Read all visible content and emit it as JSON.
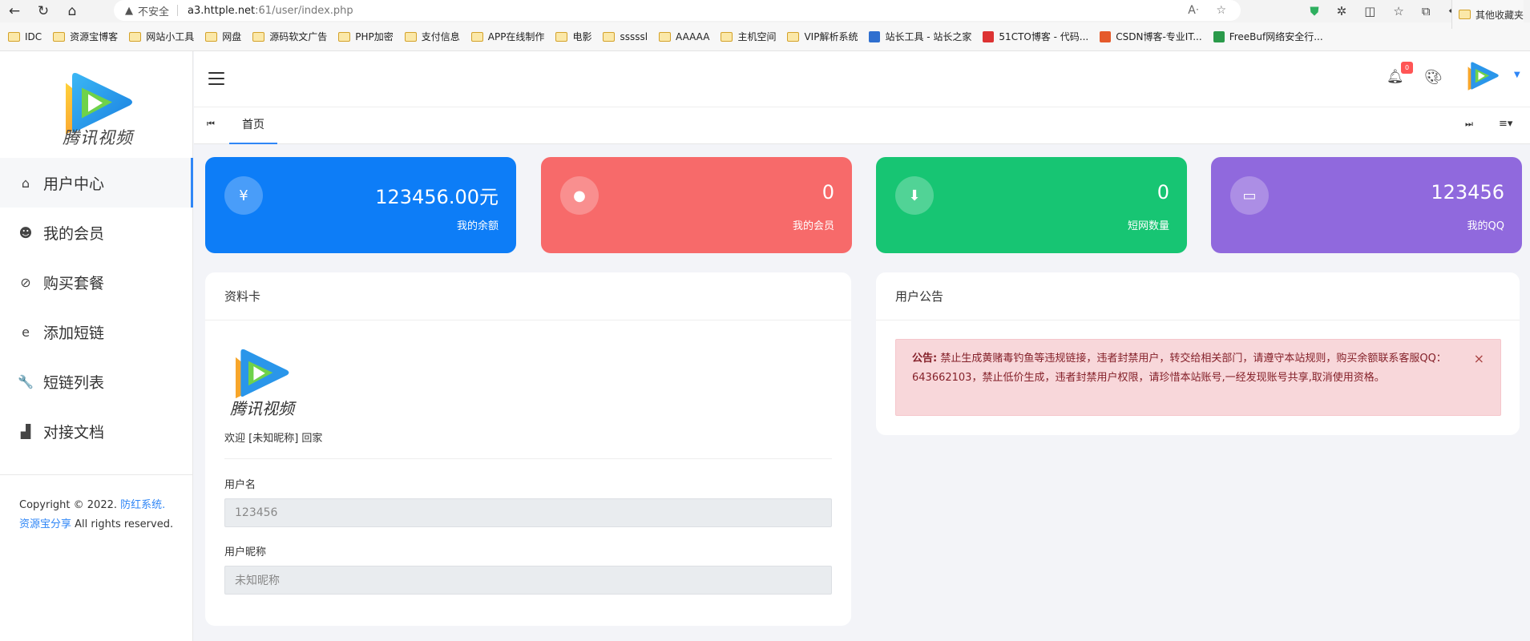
{
  "browser": {
    "insecure_label": "不安全",
    "url_host": "a3.httple.net",
    "url_path": ":61/user/index.php"
  },
  "bookmarks": [
    {
      "label": "IDC",
      "type": "folder"
    },
    {
      "label": "资源宝博客",
      "type": "folder"
    },
    {
      "label": "网站小工具",
      "type": "folder"
    },
    {
      "label": "网盘",
      "type": "folder"
    },
    {
      "label": "源码软文广告",
      "type": "folder"
    },
    {
      "label": "PHP加密",
      "type": "folder"
    },
    {
      "label": "支付信息",
      "type": "folder"
    },
    {
      "label": "APP在线制作",
      "type": "folder"
    },
    {
      "label": "电影",
      "type": "folder"
    },
    {
      "label": "sssssl",
      "type": "folder"
    },
    {
      "label": "AAAAA",
      "type": "folder"
    },
    {
      "label": "主机空间",
      "type": "folder"
    },
    {
      "label": "VIP解析系统",
      "type": "folder"
    },
    {
      "label": "站长工具 - 站长之家",
      "type": "site"
    },
    {
      "label": "51CTO博客 - 代码...",
      "type": "site"
    },
    {
      "label": "CSDN博客-专业IT...",
      "type": "site"
    },
    {
      "label": "FreeBuf网络安全行...",
      "type": "site"
    }
  ],
  "bookmarks_other": "其他收藏夹",
  "sidebar": {
    "logo_text": "腾讯视频",
    "items": [
      {
        "label": "用户中心",
        "icon": "dashboard-icon",
        "glyph": "⌂"
      },
      {
        "label": "我的会员",
        "icon": "member-face-icon",
        "glyph": "☻"
      },
      {
        "label": "购买套餐",
        "icon": "compass-icon",
        "glyph": "⊘"
      },
      {
        "label": "添加短链",
        "icon": "edge-e-icon",
        "glyph": "e"
      },
      {
        "label": "短链列表",
        "icon": "wrench-icon",
        "glyph": "🔧"
      },
      {
        "label": "对接文档",
        "icon": "bar-chart-icon",
        "glyph": "▟"
      }
    ],
    "copyright_prefix": "Copyright © 2022.",
    "copyright_link1": "防红系统.",
    "copyright_link2": "资源宝分享",
    "copyright_suffix": "All rights reserved."
  },
  "header": {
    "bell_count": "0",
    "tab_home": "首页"
  },
  "stats": [
    {
      "value": "123456.00元",
      "label": "我的余额",
      "color": "#0d7df7",
      "icon": "yen-icon",
      "glyph": "¥"
    },
    {
      "value": "0",
      "label": "我的会员",
      "color": "#f76a6a",
      "icon": "user-icon",
      "glyph": "●"
    },
    {
      "value": "0",
      "label": "短网数量",
      "color": "#17c573",
      "icon": "download-arrow-icon",
      "glyph": "⬇"
    },
    {
      "value": "123456",
      "label": "我的QQ",
      "color": "#9069dd",
      "icon": "chat-bubble-icon",
      "glyph": "▭"
    }
  ],
  "profile": {
    "title": "资料卡",
    "logo_text": "腾讯视频",
    "welcome": "欢迎 [未知昵称] 回家",
    "username_label": "用户名",
    "username_value": "123456",
    "nickname_label": "用户昵称",
    "nickname_value": "未知昵称"
  },
  "notice": {
    "title": "用户公告",
    "prefix": "公告:",
    "text": "禁止生成黄赌毒钓鱼等违规链接，违者封禁用户，转交给相关部门，请遵守本站规则，购买余额联系客服QQ：643662103，禁止低价生成，违者封禁用户权限，请珍惜本站账号,一经发现账号共享,取消使用资格。",
    "close": "×"
  }
}
